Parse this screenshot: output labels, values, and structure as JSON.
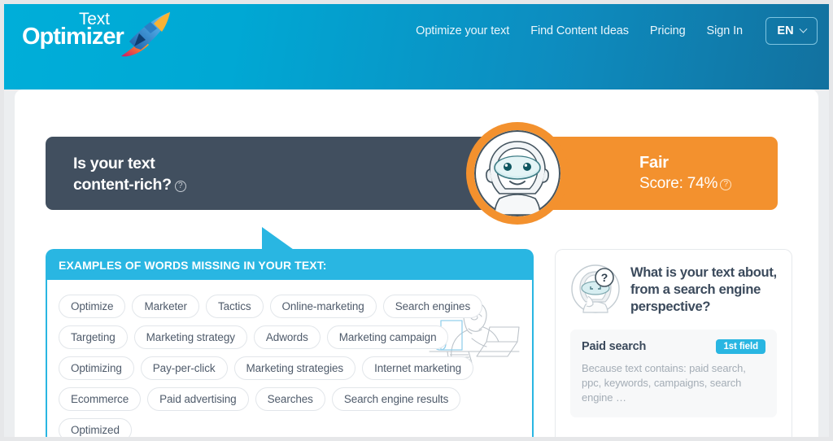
{
  "brand": {
    "logo_top": "Text",
    "logo_bottom": "Optimizer",
    "rocket_icon": "rocket-pencil-icon"
  },
  "nav": {
    "items": [
      {
        "label": "Optimize your text"
      },
      {
        "label": "Find Content Ideas"
      },
      {
        "label": "Pricing"
      },
      {
        "label": "Sign In"
      }
    ],
    "language": {
      "value": "EN",
      "chevron_icon": "chevron-down-icon"
    }
  },
  "score_banner": {
    "question_line1": "Is your text",
    "question_line2": "content-rich?",
    "help_icon": "question-circle-icon",
    "rating": "Fair",
    "score_label": "Score: 74%",
    "score_percent": 74,
    "score_help_icon": "question-circle-icon",
    "mascot_icon": "robot-avatar-icon",
    "dark_color": "#414f5f",
    "accent_color": "#f3912e"
  },
  "words_panel": {
    "header": "EXAMPLES OF WORDS MISSING IN YOUR TEXT:",
    "accent_color": "#29b6e2",
    "illustration_icon": "woman-at-laptop-illustration",
    "chips": [
      "Optimize",
      "Marketer",
      "Tactics",
      "Online-marketing",
      "Search engines",
      "Targeting",
      "Marketing strategy",
      "Adwords",
      "Marketing campaign",
      "Optimizing",
      "Pay-per-click",
      "Marketing strategies",
      "Internet marketing",
      "Ecommerce",
      "Paid advertising",
      "Searches",
      "Search engine results",
      "Optimized"
    ]
  },
  "side_panel": {
    "robot_icon": "robot-question-icon",
    "title": "What is your text about, from a search engine perspective?",
    "field": {
      "name": "Paid search",
      "badge": "1st field",
      "description": "Because text contains:   paid search, ppc, keywords, campaigns, search engine …"
    }
  }
}
